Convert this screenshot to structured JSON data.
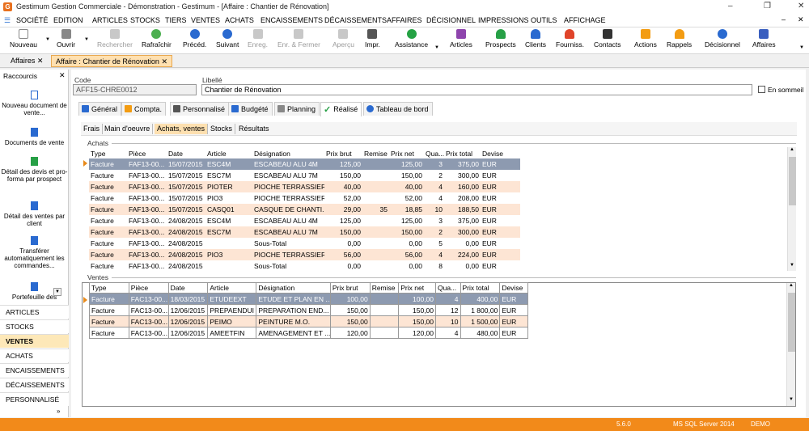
{
  "window": {
    "title": "Gestimum Gestion Commerciale - Démonstration - Gestimum - [Affaire : Chantier de Rénovation]"
  },
  "menu": [
    "Société",
    "Edition",
    "Articles",
    "Stocks",
    "Tiers",
    "Ventes",
    "Achats",
    "Encaissements",
    "Décaissements",
    "Affaires",
    "Décisionnel",
    "Impressions",
    "Outils",
    "Affichage"
  ],
  "toolbar": {
    "nouveau": "Nouveau",
    "ouvrir": "Ouvrir",
    "rechercher": "Rechercher",
    "rafraichir": "Rafraîchir",
    "preced": "Précéd.",
    "suivant": "Suivant",
    "enreg": "Enreg.",
    "enr_fermer": "Enr. & Fermer",
    "apercu": "Aperçu",
    "impr": "Impr.",
    "assistance": "Assistance",
    "articles": "Articles",
    "prospects": "Prospects",
    "clients": "Clients",
    "fourniss": "Fourniss.",
    "contacts": "Contacts",
    "actions": "Actions",
    "rappels": "Rappels",
    "decisionnel": "Décisionnel",
    "affaires": "Affaires"
  },
  "doc_tabs": {
    "tab1": "Affaires",
    "tab2": "Affaire : Chantier de Rénovation"
  },
  "sidebar": {
    "title": "Raccourcis",
    "shortcuts": [
      "Nouveau document de vente...",
      "Documents de vente",
      "Détail des devis et pro-forma par prospect",
      "Détail des ventes par client",
      "Transférer automatiquement les commandes...",
      "Portefeuille des"
    ],
    "nav": [
      "Articles",
      "Stocks",
      "Ventes",
      "Achats",
      "Encaissements",
      "Décaissements",
      "Personnalisé"
    ]
  },
  "form": {
    "code_label": "Code",
    "code_value": "AFF15-CHRE0012",
    "libelle_label": "Libellé",
    "libelle_value": "Chantier de Rénovation",
    "sommeil_label": "En sommeil"
  },
  "inner_tabs": [
    "Général",
    "Compta.",
    "Personnalisé",
    "Budgété",
    "Planning",
    "Réalisé",
    "Tableau de bord"
  ],
  "sub_tabs": [
    "Frais",
    "Main d'oeuvre",
    "Achats, ventes",
    "Stocks",
    "Résultats"
  ],
  "achats": {
    "title": "Achats",
    "columns": [
      "Type",
      "Pièce",
      "Date",
      "Article",
      "Désignation",
      "Prix brut",
      "Remise",
      "Prix net",
      "Qua...",
      "Prix total",
      "Devise"
    ],
    "rows": [
      [
        "Facture",
        "FAF13-00...",
        "15/07/2015",
        "ESC4M",
        "ESCABEAU ALU 4M",
        "125,00",
        "",
        "125,00",
        "3",
        "375,00",
        "EUR"
      ],
      [
        "Facture",
        "FAF13-00...",
        "15/07/2015",
        "ESC7M",
        "ESCABEAU ALU 7M",
        "150,00",
        "",
        "150,00",
        "2",
        "300,00",
        "EUR"
      ],
      [
        "Facture",
        "FAF13-00...",
        "15/07/2015",
        "PIOTER",
        "PIOCHE TERRASSIER...",
        "40,00",
        "",
        "40,00",
        "4",
        "160,00",
        "EUR"
      ],
      [
        "Facture",
        "FAF13-00...",
        "15/07/2015",
        "PIO3",
        "PIOCHE TERRASSIER...",
        "52,00",
        "",
        "52,00",
        "4",
        "208,00",
        "EUR"
      ],
      [
        "Facture",
        "FAF13-00...",
        "15/07/2015",
        "CASQ01",
        "CASQUE DE CHANTI...",
        "29,00",
        "35",
        "18,85",
        "10",
        "188,50",
        "EUR"
      ],
      [
        "Facture",
        "FAF13-00...",
        "24/08/2015",
        "ESC4M",
        "ESCABEAU ALU 4M",
        "125,00",
        "",
        "125,00",
        "3",
        "375,00",
        "EUR"
      ],
      [
        "Facture",
        "FAF13-00...",
        "24/08/2015",
        "ESC7M",
        "ESCABEAU ALU 7M",
        "150,00",
        "",
        "150,00",
        "2",
        "300,00",
        "EUR"
      ],
      [
        "Facture",
        "FAF13-00...",
        "24/08/2015",
        "",
        "Sous-Total",
        "0,00",
        "",
        "0,00",
        "5",
        "0,00",
        "EUR"
      ],
      [
        "Facture",
        "FAF13-00...",
        "24/08/2015",
        "PIO3",
        "PIOCHE TERRASSIER...",
        "56,00",
        "",
        "56,00",
        "4",
        "224,00",
        "EUR"
      ],
      [
        "Facture",
        "FAF13-00...",
        "24/08/2015",
        "",
        "Sous-Total",
        "0,00",
        "",
        "0,00",
        "8",
        "0,00",
        "EUR"
      ]
    ]
  },
  "ventes": {
    "title": "Ventes",
    "columns": [
      "Type",
      "Pièce",
      "Date",
      "Article",
      "Désignation",
      "Prix brut",
      "Remise",
      "Prix net",
      "Qua...",
      "Prix total",
      "Devise"
    ],
    "rows": [
      [
        "Facture",
        "FAC13-00...",
        "18/03/2015",
        "ETUDEEXT",
        "ETUDE ET PLAN EN ...",
        "100,00",
        "",
        "100,00",
        "4",
        "400,00",
        "EUR"
      ],
      [
        "Facture",
        "FAC13-00...",
        "12/06/2015",
        "PREPAENDUI",
        "PREPARATION END...",
        "150,00",
        "",
        "150,00",
        "12",
        "1 800,00",
        "EUR"
      ],
      [
        "Facture",
        "FAC13-00...",
        "12/06/2015",
        "PEIMO",
        "PEINTURE M.O.",
        "150,00",
        "",
        "150,00",
        "10",
        "1 500,00",
        "EUR"
      ],
      [
        "Facture",
        "FAC13-00...",
        "12/06/2015",
        "AMEETFIN",
        "AMENAGEMENT ET ...",
        "120,00",
        "",
        "120,00",
        "4",
        "480,00",
        "EUR"
      ]
    ]
  },
  "status": {
    "version": "5.6.0",
    "db": "MS SQL Server 2014",
    "mode": "DEMO"
  }
}
